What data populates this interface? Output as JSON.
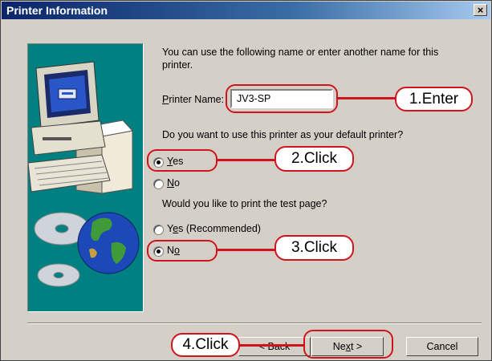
{
  "window": {
    "title": "Printer Information",
    "close_label": "×"
  },
  "intro": {
    "line1": "You can use the following name or enter another name for this",
    "line2": "printer."
  },
  "printer_name": {
    "label_accel": "P",
    "label_rest": "rinter Name:",
    "value": "JV3-SP"
  },
  "default_printer": {
    "question": "Do you want to use this printer as your default printer?",
    "options": [
      {
        "accel": "Y",
        "rest": "es",
        "selected": true
      },
      {
        "accel": "N",
        "rest": "o",
        "selected": false
      }
    ]
  },
  "test_page": {
    "question": "Would you like to print the test page?",
    "options": [
      {
        "pre": "Y",
        "accel": "e",
        "rest": "s (Recommended)",
        "selected": false
      },
      {
        "pre": "N",
        "accel": "o",
        "rest": "",
        "selected": true
      }
    ]
  },
  "buttons": {
    "back": "< Back",
    "next_pre": "Ne",
    "next_accel": "x",
    "next_rest": "t >",
    "cancel": "Cancel"
  },
  "callouts": {
    "enter": "1.Enter",
    "click2": "2.Click",
    "click3": "3.Click",
    "click4": "4.Click"
  },
  "colors": {
    "title_bar": "#0a246a",
    "callout_border": "#d0141e",
    "art_background": "#008080"
  },
  "icons": [
    "close-icon",
    "computer-icon",
    "printer-icon",
    "cd-icon",
    "globe-icon"
  ]
}
